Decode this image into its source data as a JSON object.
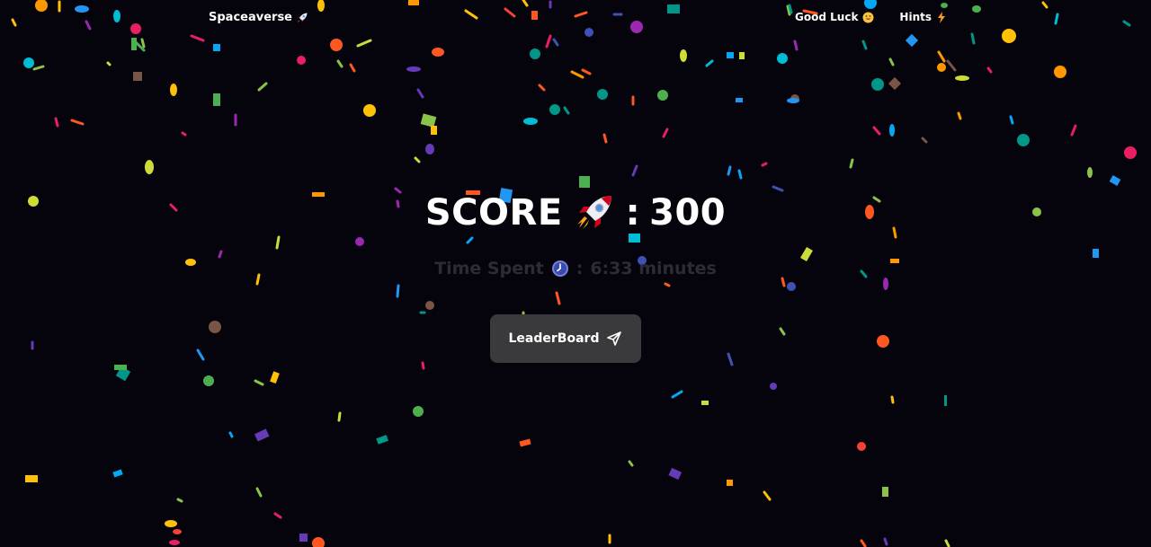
{
  "app": {
    "brand_label": "Spaceaverse",
    "brand_icon": "rocket-icon"
  },
  "nav": {
    "good_luck_label": "Good Luck",
    "good_luck_icon": "smile-face-icon",
    "hints_label": "Hints",
    "hints_icon": "lightning-icon"
  },
  "score": {
    "label": "SCORE",
    "icon": "rocket-icon",
    "separator": ":",
    "value": "300"
  },
  "time": {
    "label": "Time Spent",
    "icon": "clock-icon",
    "separator": ":",
    "value": "6:33 minutes"
  },
  "leaderboard": {
    "button_label": "LeaderBoard",
    "button_icon": "send-icon"
  },
  "colors": {
    "background": "#05040c",
    "button_bg": "#3a3a3c",
    "time_text": "#2c2c34",
    "confetti": [
      "#ffc107",
      "#03a9f4",
      "#e91e63",
      "#8bc34a",
      "#9c27b0",
      "#ff5722",
      "#009688",
      "#cddc39",
      "#673ab7",
      "#2196f3",
      "#ff9800",
      "#4caf50",
      "#795548",
      "#00bcd4",
      "#f44336",
      "#3f51b5"
    ]
  }
}
